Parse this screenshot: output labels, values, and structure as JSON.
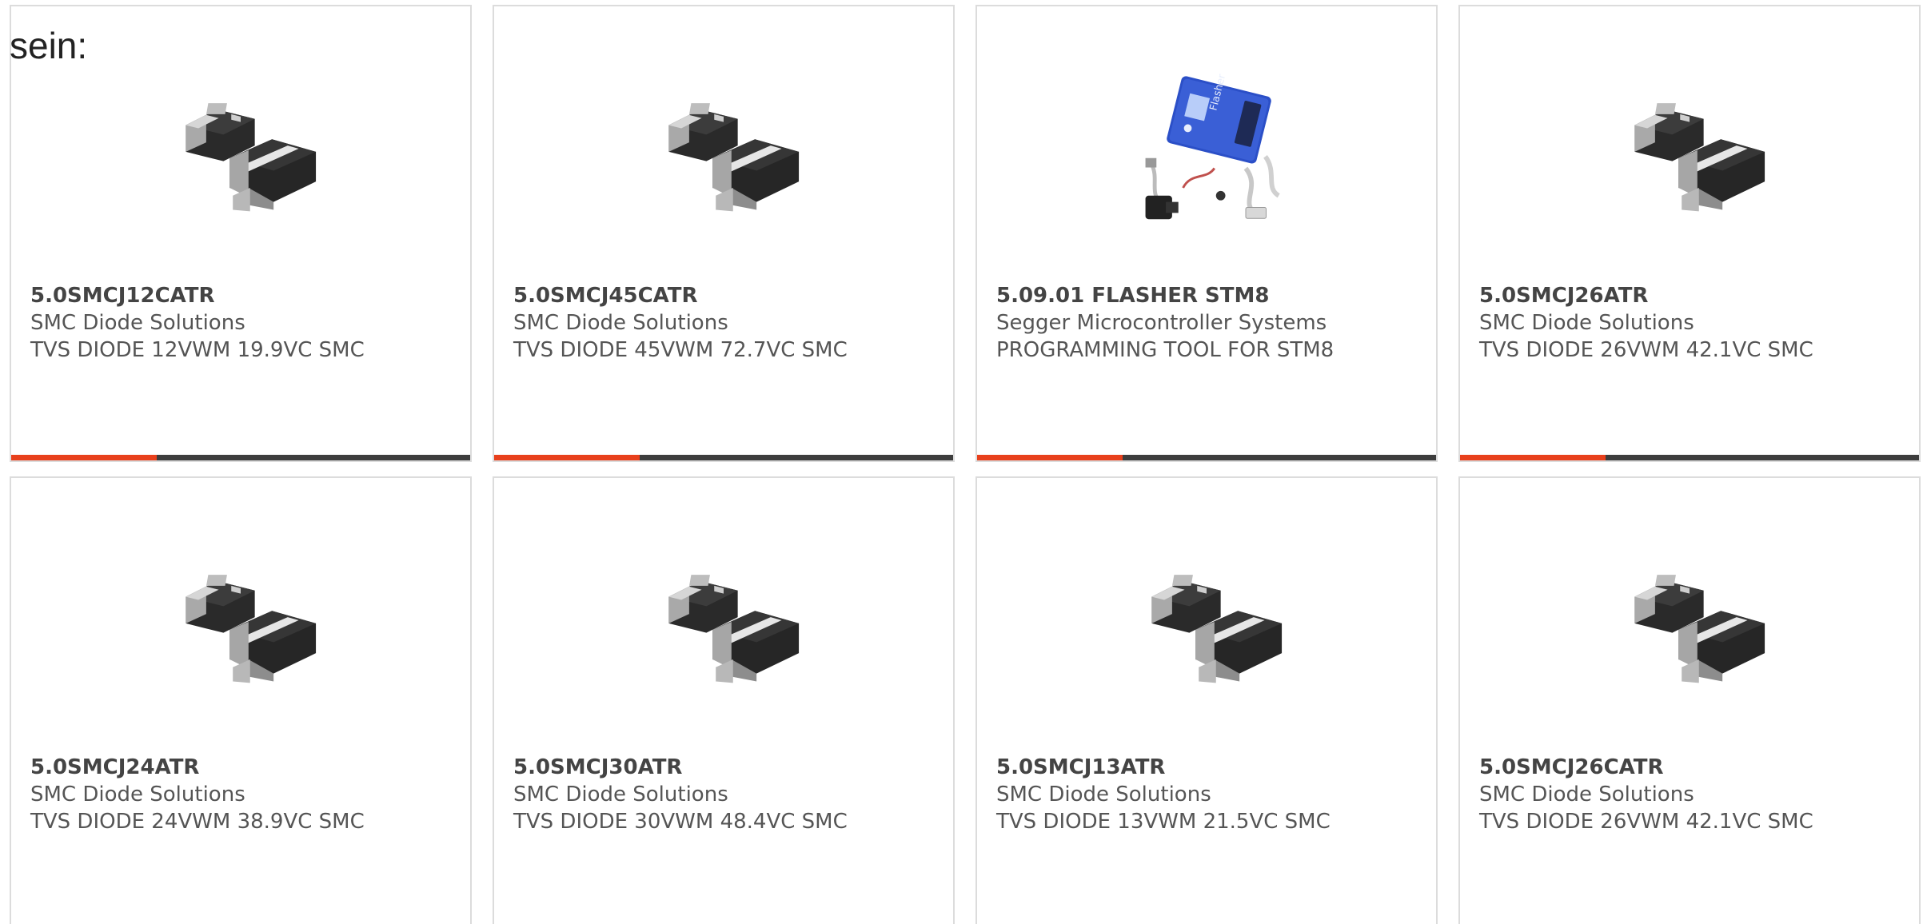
{
  "prefix_text": "sein:",
  "colors": {
    "accent": "#e8401c",
    "bar_dark": "#3d3d3d",
    "card_border": "#dcdcdc"
  },
  "products": [
    {
      "part_number": "5.0SMCJ12CATR",
      "manufacturer": "SMC Diode Solutions",
      "description": "TVS DIODE 12VWM 19.9VC SMC",
      "image": "smc-diode-package-image"
    },
    {
      "part_number": "5.0SMCJ45CATR",
      "manufacturer": "SMC Diode Solutions",
      "description": "TVS DIODE 45VWM 72.7VC SMC",
      "image": "smc-diode-package-image"
    },
    {
      "part_number": "5.09.01 FLASHER STM8",
      "manufacturer": "Segger Microcontroller Systems",
      "description": "PROGRAMMING TOOL FOR STM8",
      "image": "flasher-programmer-image"
    },
    {
      "part_number": "5.0SMCJ26ATR",
      "manufacturer": "SMC Diode Solutions",
      "description": "TVS DIODE 26VWM 42.1VC SMC",
      "image": "smc-diode-package-image"
    },
    {
      "part_number": "5.0SMCJ24ATR",
      "manufacturer": "SMC Diode Solutions",
      "description": "TVS DIODE 24VWM 38.9VC SMC",
      "image": "smc-diode-package-image"
    },
    {
      "part_number": "5.0SMCJ30ATR",
      "manufacturer": "SMC Diode Solutions",
      "description": "TVS DIODE 30VWM 48.4VC SMC",
      "image": "smc-diode-package-image"
    },
    {
      "part_number": "5.0SMCJ13ATR",
      "manufacturer": "SMC Diode Solutions",
      "description": "TVS DIODE 13VWM 21.5VC SMC",
      "image": "smc-diode-package-image"
    },
    {
      "part_number": "5.0SMCJ26CATR",
      "manufacturer": "SMC Diode Solutions",
      "description": "TVS DIODE 26VWM 42.1VC SMC",
      "image": "smc-diode-package-image"
    }
  ]
}
